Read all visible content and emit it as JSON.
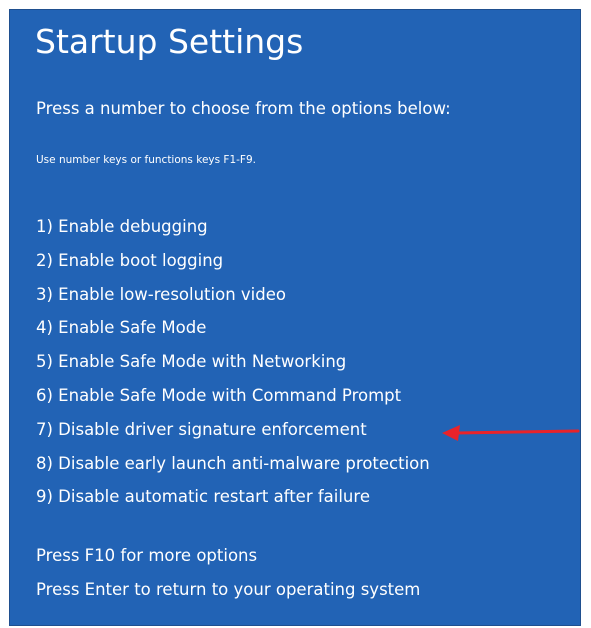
{
  "screen": {
    "title": "Startup Settings",
    "instruction": "Press a number to choose from the options below:",
    "hint": "Use number keys or functions keys F1-F9.",
    "options": [
      "1) Enable debugging",
      "2) Enable boot logging",
      "3) Enable low-resolution video",
      "4) Enable Safe Mode",
      "5) Enable Safe Mode with Networking",
      "6) Enable Safe Mode with Command Prompt",
      "7) Disable driver signature enforcement",
      "8) Disable early launch anti-malware protection",
      "9) Disable automatic restart after failure"
    ],
    "footer": [
      "Press F10 for more options",
      "Press Enter to return to your operating system"
    ]
  },
  "colors": {
    "background": "#2263b5",
    "text": "#ffffff",
    "arrow": "#e8232a"
  },
  "annotation": {
    "icon": "red-arrow-icon",
    "points_to_option": 7
  }
}
